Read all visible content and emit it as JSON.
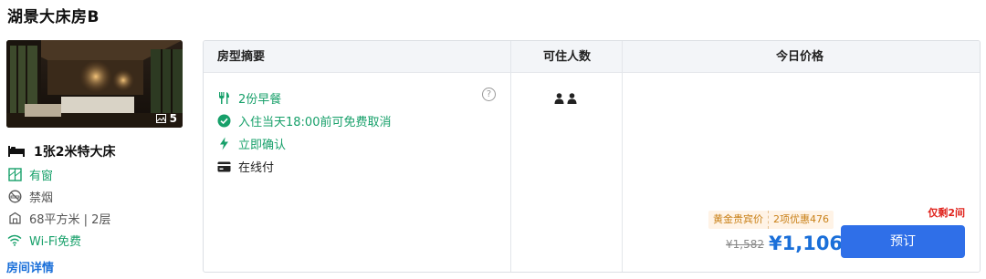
{
  "room": {
    "title": "湖景大床房B",
    "photo_count": "5",
    "bed": "1张2米特大床",
    "window": "有窗",
    "smoking": "禁烟",
    "size_floor": "68平方米 | 2层",
    "wifi": "Wi-Fi免费",
    "details_link": "房间详情"
  },
  "table": {
    "headers": [
      "房型摘要",
      "可住人数",
      "今日价格"
    ],
    "policies": [
      {
        "icon": "utensils-icon",
        "text": "2份早餐",
        "color": "#17a06a"
      },
      {
        "icon": "check-circle-icon",
        "text": "入住当天18:00前可免费取消",
        "color": "#17a06a"
      },
      {
        "icon": "lightning-icon",
        "text": "立即确认",
        "color": "#17a06a"
      },
      {
        "icon": "card-icon",
        "text": "在线付",
        "color": "#222222"
      }
    ],
    "help_mark": "?",
    "occupancy_count": 2
  },
  "price": {
    "rooms_left": "仅剩2间",
    "tag_member": "黄金贵宾价",
    "tag_discount": "2项优惠476",
    "original": "¥1,582",
    "current": "¥1,106",
    "book_label": "预订"
  },
  "colors": {
    "accent": "#2f6fe8",
    "green": "#17a06a",
    "red": "#e0221c",
    "price_blue": "#1a6fd9"
  }
}
